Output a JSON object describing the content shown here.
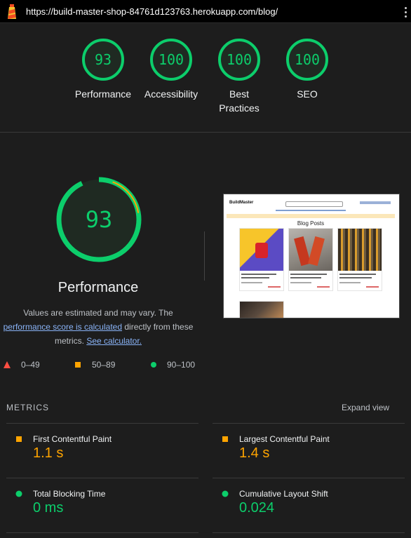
{
  "header": {
    "url": "https://build-master-shop-84761d123763.herokuapp.com/blog/",
    "logo_icon": "lighthouse-icon",
    "menu_icon": "kebab-menu-icon"
  },
  "scores": [
    {
      "label": "Performance",
      "value": "93"
    },
    {
      "label": "Accessibility",
      "value": "100"
    },
    {
      "label": "Best Practices",
      "value": "100"
    },
    {
      "label": "SEO",
      "value": "100"
    }
  ],
  "performance": {
    "score": "93",
    "title": "Performance",
    "desc_1": "Values are estimated and may vary. The",
    "link_1": "performance score is calculated",
    "desc_2": "directly from these metrics.",
    "link_2": "See calculator."
  },
  "legend": [
    {
      "range": "0–49",
      "shape": "triangle",
      "color": "#ff4e42"
    },
    {
      "range": "50–89",
      "shape": "square",
      "color": "#ffa400"
    },
    {
      "range": "90–100",
      "shape": "circle",
      "color": "#0cce6b"
    }
  ],
  "screenshot": {
    "brand": "BuildMaster",
    "title": "Blog Posts"
  },
  "metrics": {
    "heading": "METRICS",
    "expand_label": "Expand view",
    "items": [
      {
        "label": "First Contentful Paint",
        "value": "1.1 s",
        "status": "average",
        "color": "#ffa400"
      },
      {
        "label": "Largest Contentful Paint",
        "value": "1.4 s",
        "status": "average",
        "color": "#ffa400"
      },
      {
        "label": "Total Blocking Time",
        "value": "0 ms",
        "status": "pass",
        "color": "#0cce6b"
      },
      {
        "label": "Cumulative Layout Shift",
        "value": "0.024",
        "status": "pass",
        "color": "#0cce6b"
      }
    ]
  },
  "colors": {
    "pass": "#0cce6b",
    "average": "#ffa400",
    "fail": "#ff4e42",
    "background": "#1d1d1d"
  }
}
